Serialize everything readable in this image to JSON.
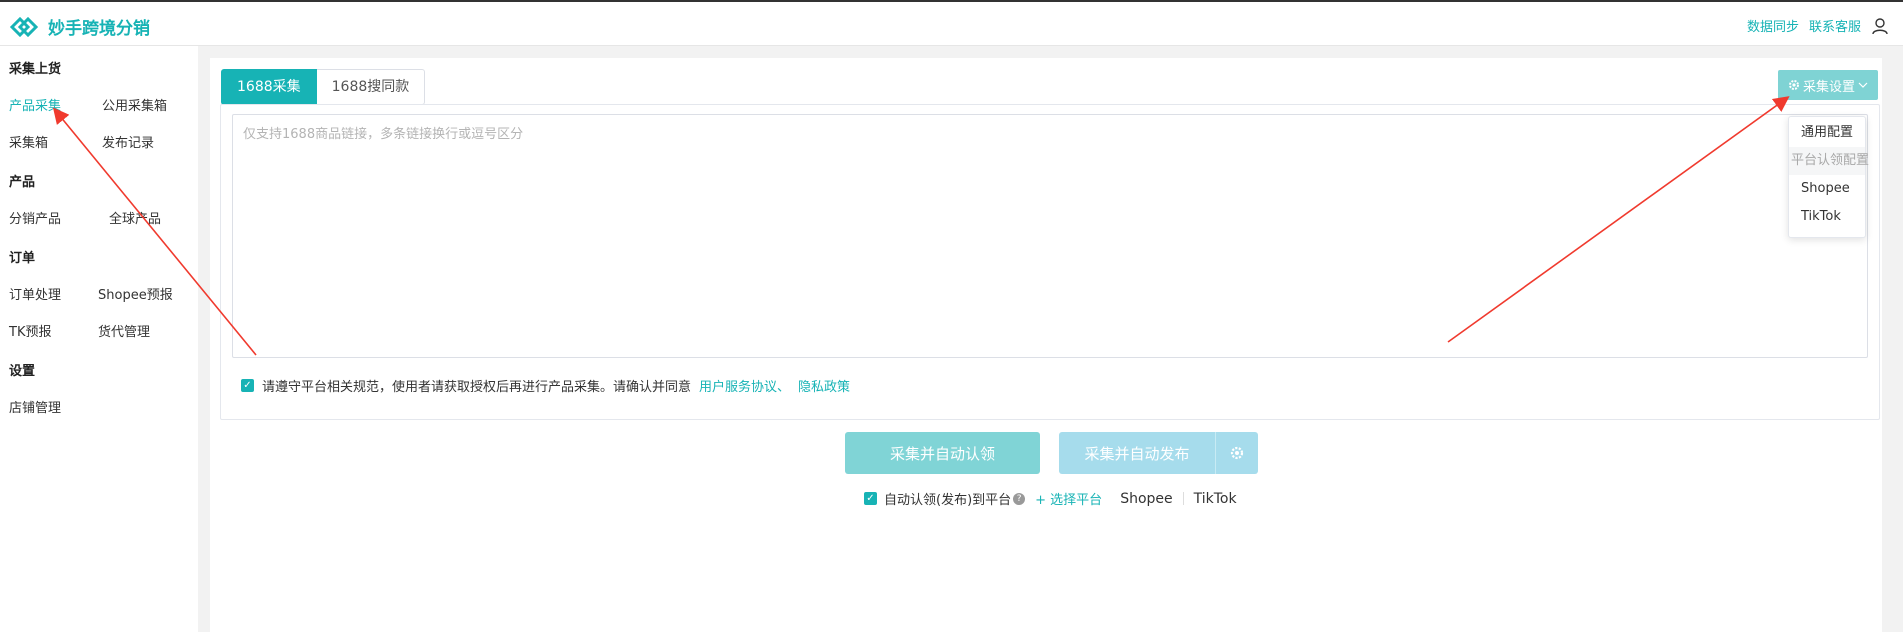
{
  "app": {
    "title": "妙手跨境分销"
  },
  "header": {
    "sync_label": "数据同步",
    "contact_label": "联系客服"
  },
  "sidebar": {
    "sections": [
      {
        "title": "采集上货",
        "items": [
          "产品采集",
          "公用采集箱",
          "采集箱",
          "发布记录"
        ]
      },
      {
        "title": "产品",
        "items": [
          "分销产品",
          "全球产品"
        ]
      },
      {
        "title": "订单",
        "items": [
          "订单处理",
          "Shopee预报",
          "TK预报",
          "货代管理"
        ]
      },
      {
        "title": "设置",
        "items": [
          "店铺管理"
        ]
      }
    ],
    "active_item": "产品采集"
  },
  "tabs": [
    "1688采集",
    "1688搜同款"
  ],
  "collect": {
    "placeholder": "仅支持1688商品链接，多条链接换行或逗号区分",
    "value": "",
    "agreement_text": "请遵守平台相关规范，使用者请获取授权后再进行产品采集。请确认并同意",
    "agreement_link1": "用户服务协议、",
    "agreement_link2": "隐私政策",
    "agreement_checked": true
  },
  "settings": {
    "button_label": "采集设置",
    "menu": [
      "通用配置",
      "平台认领配置",
      "Shopee",
      "TikTok"
    ],
    "menu_disabled": [
      false,
      true,
      false,
      false
    ]
  },
  "actions": {
    "claim_label": "采集并自动认领",
    "publish_label": "采集并自动发布"
  },
  "auto": {
    "label": "自动认领(发布)到平台",
    "help": "?",
    "choose_label": "+ 选择平台",
    "platforms": [
      "Shopee",
      "TikTok"
    ],
    "checked": true
  },
  "colors": {
    "accent": "#17b3b5",
    "button_light": "#80d4d6",
    "button_publish": "#a6dcec",
    "annotation_arrow": "#f03a2e"
  }
}
